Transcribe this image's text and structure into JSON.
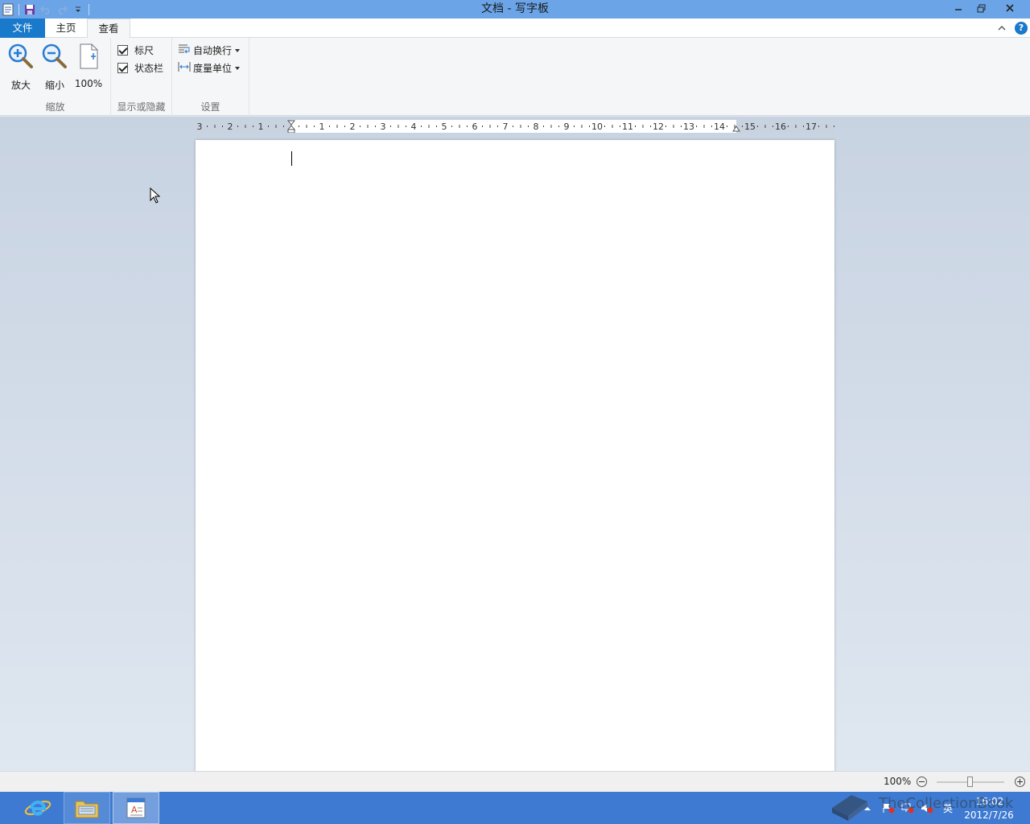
{
  "window": {
    "title": "文档 - 写字板"
  },
  "tabs": {
    "file": "文件",
    "home": "主页",
    "view": "查看"
  },
  "ribbon": {
    "zoom": {
      "label": "缩放",
      "zoom_in": "放大",
      "zoom_out": "缩小",
      "actual": "100%"
    },
    "show_hide": {
      "label": "显示或隐藏",
      "ruler": "标尺",
      "ruler_checked": true,
      "status_bar": "状态栏",
      "status_bar_checked": true
    },
    "settings": {
      "label": "设置",
      "word_wrap": "自动换行",
      "measurement_units": "度量单位"
    }
  },
  "ruler": {
    "left_labels": [
      "3",
      "2",
      "1"
    ],
    "right_labels": [
      "1",
      "2",
      "3",
      "4",
      "5",
      "6",
      "7",
      "8",
      "9",
      "10",
      "11",
      "12",
      "13",
      "14",
      "15",
      "16",
      "17"
    ]
  },
  "statusbar": {
    "zoom_level": "100%",
    "zoom_fraction": 0.5
  },
  "taskbar": {
    "apps": [
      "internet-explorer",
      "file-explorer",
      "wordpad"
    ],
    "ime": "英",
    "time": "16:02",
    "date": "2012/7/26"
  },
  "watermark": "TheCollectionBook",
  "colors": {
    "title_bar": "#6ba5e8",
    "file_tab": "#1979ca",
    "taskbar": "#3e7ad1"
  }
}
